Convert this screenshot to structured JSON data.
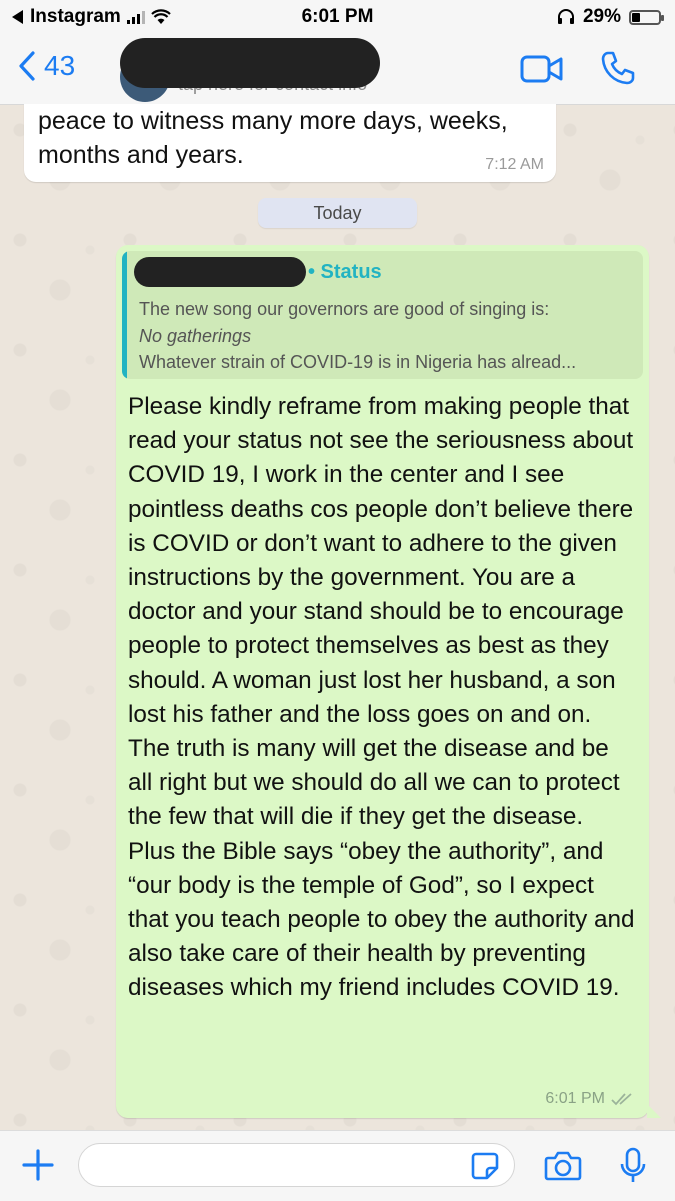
{
  "status_bar": {
    "back_app": "Instagram",
    "time": "6:01 PM",
    "battery": "29%",
    "battery_level": 0.29,
    "icons": [
      "back-arrow-icon",
      "cellular-signal-icon",
      "wifi-icon",
      "headphones-icon",
      "battery-icon"
    ]
  },
  "header": {
    "back_count": "43",
    "contact_subtitle": "tap here for contact info",
    "actions": [
      "video-call-icon",
      "phone-call-icon"
    ]
  },
  "messages": {
    "incoming": {
      "text": "peace to witness many more days, weeks, months and years.",
      "time": "7:12 AM"
    },
    "date_divider": "Today",
    "outgoing": {
      "quote": {
        "sender_suffix": "• Status",
        "line1": "The new song our governors are good of singing is:",
        "line2": "No gatherings",
        "line3": "Whatever strain of COVID-19 is in Nigeria has alread..."
      },
      "paragraph1": "Please kindly reframe from making people that read your status not see the seriousness about COVID 19, I work in the center and I see pointless deaths cos people don’t believe there is COVID or don’t want to adhere to the given instructions by the government. You are a doctor and your stand should be to encourage people to protect themselves as best as they should. A woman just lost her husband, a son lost his father and the loss goes on and on. The truth is many will get the disease and be all right but we should do all we can to protect the few that will die if they get the disease.",
      "paragraph2": "Plus the Bible says “obey the authority”, and “our body is the temple of God”, so I expect that you teach people to obey the authority and also take care of their health by preventing diseases which my friend includes COVID 19.",
      "time": "6:01 PM",
      "read_status": "double-check-icon"
    }
  },
  "input_bar": {
    "placeholder": "",
    "icons": [
      "plus-icon",
      "sticker-icon",
      "camera-icon",
      "microphone-icon"
    ]
  },
  "colors": {
    "accent": "#1c7cf2",
    "outgoing_bubble": "#dcf8c6",
    "quote_accent": "#22b3c2",
    "chat_background": "#ece5dc"
  }
}
